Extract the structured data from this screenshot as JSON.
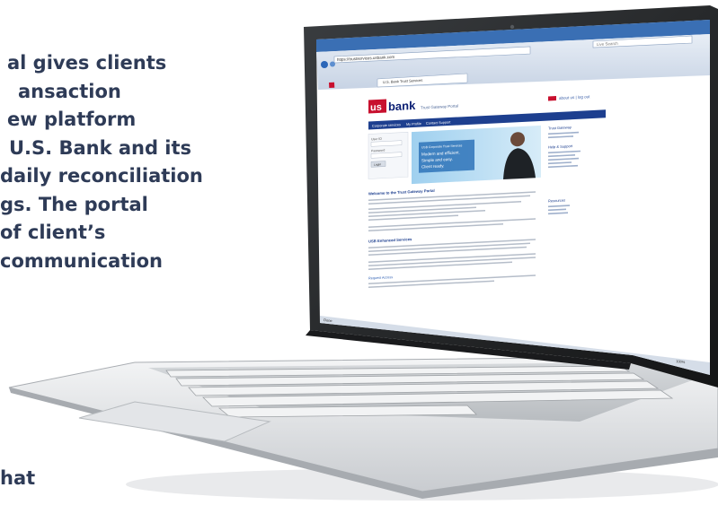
{
  "marketing_copy": {
    "lines": [
      "al gives clients",
      "ansaction",
      "ew platform",
      " U.S. Bank and its",
      "daily reconciliation",
      "gs. The portal",
      "of client’s",
      "communication"
    ],
    "trailing": "hat"
  },
  "laptop_screen": {
    "browser_address": "https://trustservices.usbank.com",
    "search_placeholder": "Live Search",
    "tab_label": "U.S. Bank Trust Services",
    "site": {
      "logo_us": "us",
      "logo_bank": "bank",
      "tagline": "Trust Gateway Portal",
      "top_right_link": "about us  |  log out",
      "nav": [
        "Corporate services",
        "My Profile",
        "Contact Support"
      ],
      "login_fields": [
        "User ID",
        "Password"
      ],
      "login_button": "Login",
      "hero_headline": [
        "Modern and efficient.",
        "Simple and easy.",
        "Client ready."
      ],
      "hero_title": "USB Corporate Trust Services",
      "right_col_headings": [
        "Trust Gateway",
        "Help & Support",
        "Resources"
      ],
      "content_heading": "Welcome to the Trust Gateway Portal",
      "content_heading_2": "USB Enhanced Services",
      "footer_link": "Request Access"
    },
    "status_bar": "Done",
    "zoom": "100%"
  },
  "colors": {
    "copy_text": "#2e3b57",
    "usbank_red": "#c8102e",
    "usbank_blue": "#0c2074",
    "nav_blue": "#1d3f8f",
    "hero_blue": "#7fbbe3"
  }
}
